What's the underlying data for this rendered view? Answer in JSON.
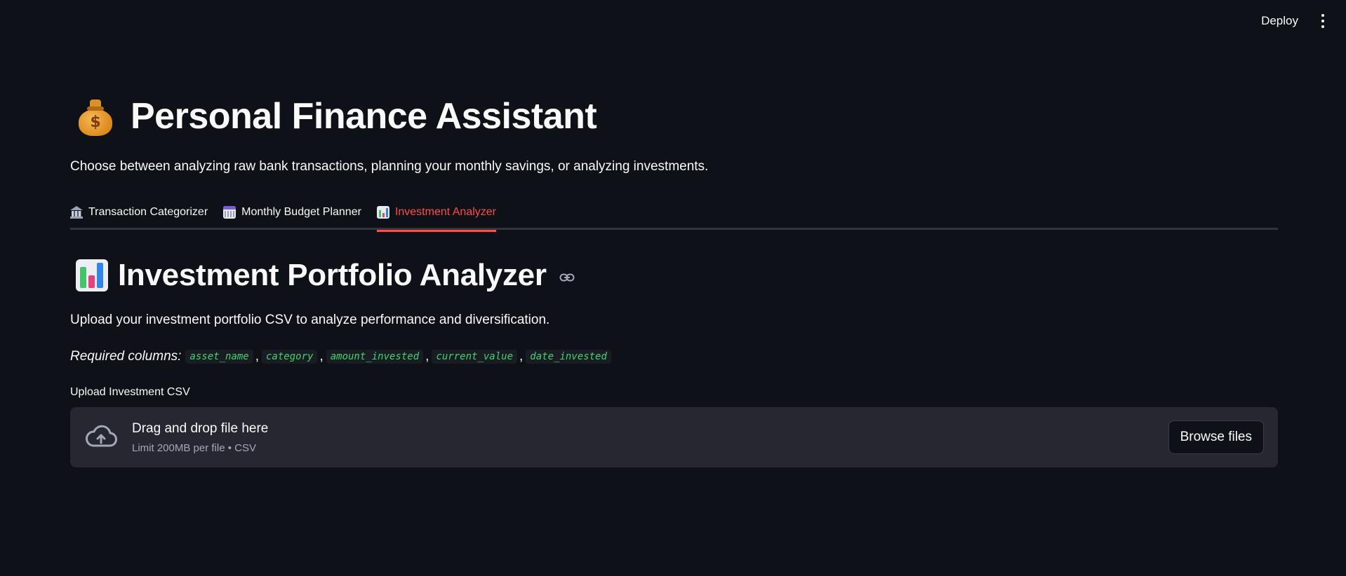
{
  "header": {
    "deploy_label": "Deploy",
    "menu_icon": "kebab-vertical-icon"
  },
  "app": {
    "title": "Personal Finance Assistant",
    "title_icon": "money-bag-icon",
    "subtitle": "Choose between analyzing raw bank transactions, planning your monthly savings, or analyzing investments."
  },
  "tabs": [
    {
      "label": "Transaction Categorizer",
      "icon": "bank-icon",
      "active": false
    },
    {
      "label": "Monthly Budget Planner",
      "icon": "calendar-icon",
      "active": false
    },
    {
      "label": "Investment Analyzer",
      "icon": "bar-chart-icon",
      "active": true
    }
  ],
  "section": {
    "title": "Investment Portfolio Analyzer",
    "title_icon": "bar-chart-icon",
    "description": "Upload your investment portfolio CSV to analyze performance and diversification.",
    "required_label": "Required columns:",
    "required_columns": [
      "asset_name",
      "category",
      "amount_invested",
      "current_value",
      "date_invested"
    ],
    "separator": ","
  },
  "uploader": {
    "label": "Upload Investment CSV",
    "drag_text": "Drag and drop file here",
    "limit_text": "Limit 200MB per file • CSV",
    "browse_label": "Browse files"
  },
  "colors": {
    "background": "#0e1117",
    "accent": "#ff4b4b",
    "code": "#3dd56d",
    "dropzone": "#262730"
  }
}
